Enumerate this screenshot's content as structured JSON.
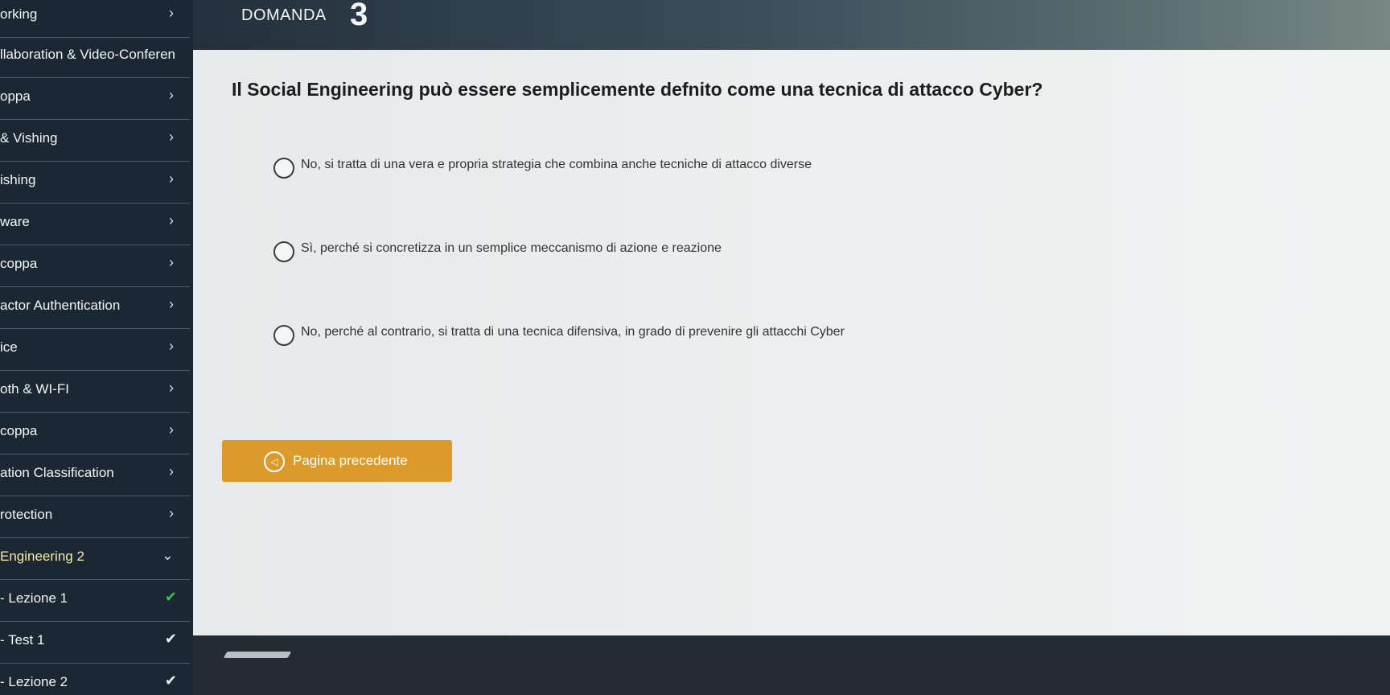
{
  "sidebar": {
    "items": [
      {
        "label": "orking",
        "state": "chevron"
      },
      {
        "label": "llaboration & Video-Conferen",
        "state": "none"
      },
      {
        "label": "oppa",
        "state": "chevron"
      },
      {
        "label": "& Vishing",
        "state": "chevron"
      },
      {
        "label": "ishing",
        "state": "chevron"
      },
      {
        "label": "ware",
        "state": "chevron"
      },
      {
        "label": "coppa",
        "state": "chevron"
      },
      {
        "label": "actor Authentication",
        "state": "chevron"
      },
      {
        "label": "ice",
        "state": "chevron"
      },
      {
        "label": "oth & WI-FI",
        "state": "chevron"
      },
      {
        "label": "coppa",
        "state": "chevron"
      },
      {
        "label": "ation Classification",
        "state": "chevron"
      },
      {
        "label": "rotection",
        "state": "chevron"
      },
      {
        "label": "Engineering 2",
        "state": "open"
      },
      {
        "label": "- Lezione 1",
        "state": "done-green"
      },
      {
        "label": "- Test 1",
        "state": "done-white"
      },
      {
        "label": "- Lezione 2",
        "state": "done-white"
      }
    ],
    "chevron_glyph": "›",
    "open_glyph": "⌄",
    "check_glyph": "✔"
  },
  "header": {
    "question_label": "DOMANDA",
    "question_number": "3"
  },
  "question": {
    "text": "Il Social Engineering può essere semplicemente defnito come una tecnica di attacco Cyber?",
    "options": [
      {
        "text": "No, si tratta di una vera e propria strategia che combina anche tecniche di attacco diverse",
        "selected": false
      },
      {
        "text": "Sì, perché si concretizza in un semplice meccanismo di azione e reazione",
        "selected": false
      },
      {
        "text": "No, perché al contrario, si tratta di una tecnica difensiva, in grado di prevenire gli attacchi Cyber",
        "selected": false
      }
    ]
  },
  "buttons": {
    "prev_label": "Pagina precedente",
    "prev_icon": "◁"
  },
  "colors": {
    "sidebar_bg": "#1b2732",
    "accent_orange": "#dc9a2d",
    "check_green": "#3fbf4a"
  }
}
